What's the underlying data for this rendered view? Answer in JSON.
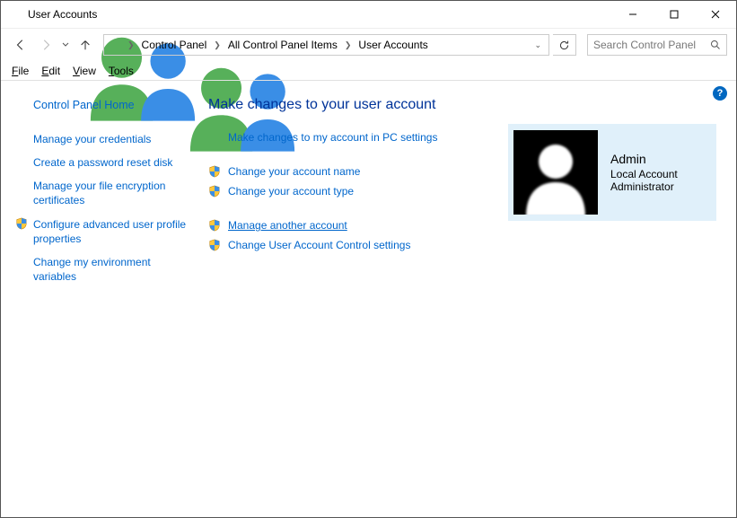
{
  "window_title": "User Accounts",
  "breadcrumb": {
    "items": [
      "Control Panel",
      "All Control Panel Items",
      "User Accounts"
    ]
  },
  "search": {
    "placeholder": "Search Control Panel"
  },
  "menu": {
    "file": "File",
    "edit": "Edit",
    "view": "View",
    "tools": "Tools"
  },
  "sidebar": {
    "home": "Control Panel Home",
    "links": [
      {
        "label": "Manage your credentials",
        "shield": false
      },
      {
        "label": "Create a password reset disk",
        "shield": false
      },
      {
        "label": "Manage your file encryption certificates",
        "shield": false
      },
      {
        "label": "Configure advanced user profile properties",
        "shield": true
      },
      {
        "label": "Change my environment variables",
        "shield": false
      }
    ]
  },
  "main": {
    "heading": "Make changes to your user account",
    "top_link": "Make changes to my account in PC settings",
    "group1": [
      {
        "label": "Change your account name",
        "shield": true
      },
      {
        "label": "Change your account type",
        "shield": true
      }
    ],
    "group2": [
      {
        "label": "Manage another account",
        "shield": true,
        "underlined": true
      },
      {
        "label": "Change User Account Control settings",
        "shield": true
      }
    ]
  },
  "account": {
    "name": "Admin",
    "type": "Local Account",
    "role": "Administrator"
  }
}
